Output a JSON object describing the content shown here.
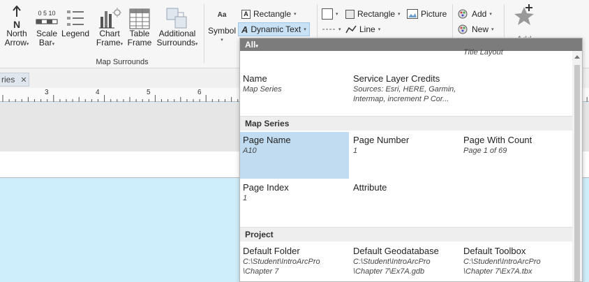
{
  "ribbon": {
    "north_arrow": "North",
    "north_arrow_2": "Arrow",
    "scale_bar": "Scale",
    "scale_bar_2": "Bar",
    "scale_numbers": "0 5 10",
    "legend": "Legend",
    "chart_frame": "Chart",
    "chart_frame_2": "Frame",
    "table_frame": "Table",
    "table_frame_2": "Frame",
    "additional": "Additional",
    "additional_2": "Surrounds",
    "group_label": "Map Surrounds",
    "symbol": "Symbol",
    "symbol_glyph": "Aa",
    "rectangle_text": "Rectangle",
    "dynamic_text": "Dynamic Text",
    "rectangle_shape": "Rectangle",
    "line": "Line",
    "picture": "Picture",
    "add": "Add",
    "new": "New",
    "add_cut": "Add"
  },
  "tab": {
    "label": "ries"
  },
  "ruler": {
    "nums": [
      "3",
      "4",
      "5",
      "6"
    ]
  },
  "gallery": {
    "filter": "All",
    "cut_text": "Title Layout",
    "rows_top": [
      {
        "title": "Name",
        "value": "Map Series"
      },
      {
        "title": "Service Layer Credits",
        "value": "Sources: Esri, HERE, Garmin,",
        "value2": "Intermap, increment P Cor..."
      }
    ],
    "map_series_header": "Map Series",
    "map_series": [
      {
        "title": "Page Name",
        "value": "A10"
      },
      {
        "title": "Page Number",
        "value": "1"
      },
      {
        "title": "Page With Count",
        "value": "Page 1 of 69"
      },
      {
        "title": "Page Index",
        "value": "1"
      },
      {
        "title": "Attribute",
        "value": ""
      }
    ],
    "project_header": "Project",
    "project": [
      {
        "title": "Default Folder",
        "value": "C:\\Student\\IntroArcPro",
        "value2": "\\Chapter 7"
      },
      {
        "title": "Default Geodatabase",
        "value": "C:\\Student\\IntroArcPro",
        "value2": "\\Chapter 7\\Ex7A.gdb"
      },
      {
        "title": "Default Toolbox",
        "value": "C:\\Student\\IntroArcPro",
        "value2": "\\Chapter 7\\Ex7A.tbx"
      }
    ]
  }
}
